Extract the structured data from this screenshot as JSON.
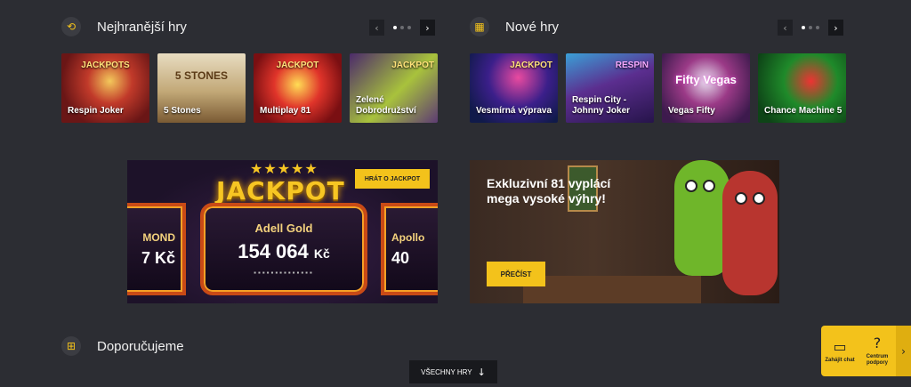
{
  "sections": {
    "popular": {
      "title": "Nejhranější hry",
      "icon": "history-icon"
    },
    "new": {
      "title": "Nové hry",
      "icon": "grid-icon"
    },
    "recommended": {
      "title": "Doporučujeme",
      "icon": "gift-icon"
    }
  },
  "carousel": {
    "prev": "‹",
    "next": "›"
  },
  "popular_games": [
    {
      "name": "Respin Joker",
      "logo": "JACKPOTS"
    },
    {
      "name": "5 Stones",
      "logo": "5 STONES"
    },
    {
      "name": "Multiplay 81",
      "logo": "JACKPOT"
    },
    {
      "name": "Zelené Dobrodružství",
      "logo": "JACKPOT"
    }
  ],
  "new_games": [
    {
      "name": "Vesmírná výprava",
      "logo": "JACKPOT"
    },
    {
      "name": "Respin City - Johnny Joker",
      "logo": "RESPIN"
    },
    {
      "name": "Vegas Fifty",
      "logo": "Fifty Vegas"
    },
    {
      "name": "Chance Machine 5",
      "logo": ""
    }
  ],
  "jackpot_banner": {
    "title": "JACKPOT",
    "stars": "★★★★★",
    "button": "HRÁT O JACKPOT",
    "center": {
      "name": "Adell Gold",
      "amount": "154 064",
      "currency": "Kč",
      "dashes": "▪▪▪▪▪▪▪▪▪▪▪▪▪▪"
    },
    "left": {
      "name": "MOND",
      "amount": "7 Kč"
    },
    "right": {
      "name": "Apollo",
      "amount": "40"
    }
  },
  "promo_banner": {
    "text": "Exkluzivní 81 vyplácí mega vysoké výhry!",
    "button": "PŘEČÍST"
  },
  "all_games": {
    "label": "VŠECHNY HRY",
    "arrow": "↓"
  },
  "support": {
    "chat_icon": "▭",
    "chat_label": "Zahájit chat",
    "help_icon": "?",
    "help_label": "Centrum podpory",
    "toggle": "›"
  },
  "colors": {
    "accent": "#f3c21b",
    "background": "#2c2d33"
  }
}
